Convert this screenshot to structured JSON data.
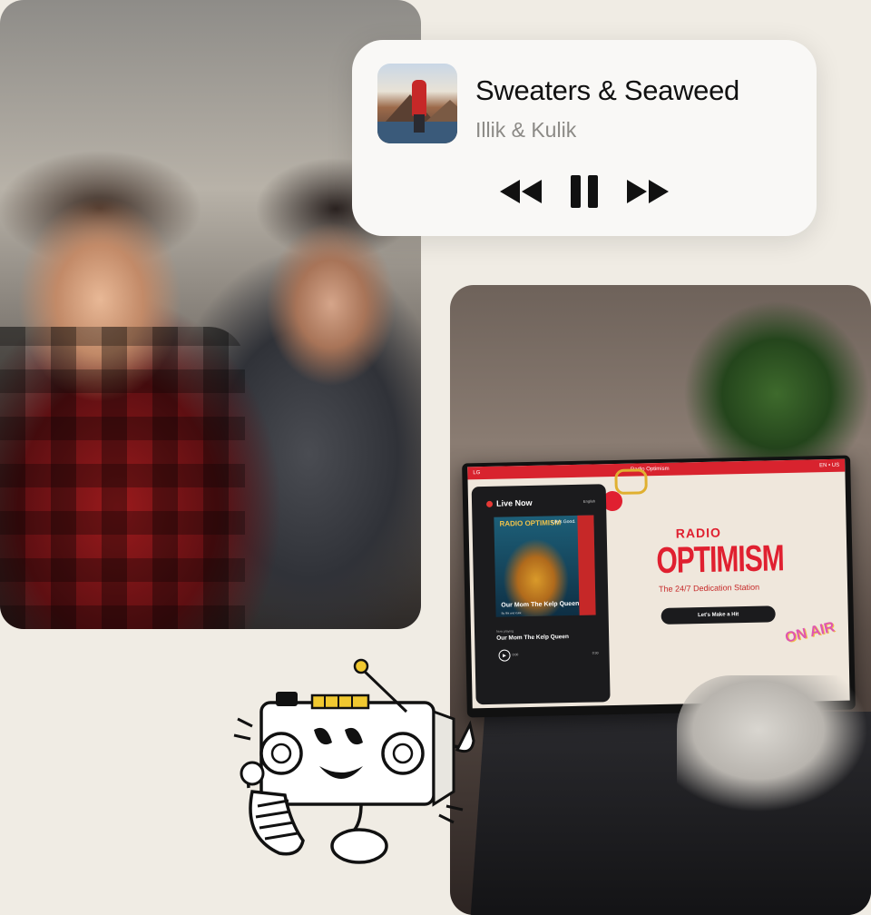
{
  "player": {
    "song_title": "Sweaters & Seaweed",
    "artist": "Illik & Kulik",
    "controls": {
      "rewind": "rewind-icon",
      "pause": "pause-icon",
      "forward": "fast-forward-icon"
    }
  },
  "laptop_screen": {
    "brand": "LG",
    "title": "Radio Optimism",
    "corner": "EN • US",
    "live_label": "Live Now",
    "lang_label": "English",
    "album_brand": "Life's Good.",
    "album_title": "RADIO OPTIMISM",
    "album_song": "Our Mom The Kelp Queen",
    "album_by": "By Illik and Kulik",
    "now_playing_label": "Now playing",
    "track": "Our Mom The Kelp Queen",
    "time_start": "0:00",
    "time_end": "0:30",
    "hero_radio": "RADIO",
    "hero_optimism": "OPTIMISM",
    "tagline": "The 24/7 Dedication Station",
    "cta": "Let's Make a Hit",
    "on_air": "ON AIR"
  },
  "colors": {
    "accent_red": "#e02030",
    "card_bg": "#f9f8f6",
    "page_bg": "#f0ece4"
  }
}
